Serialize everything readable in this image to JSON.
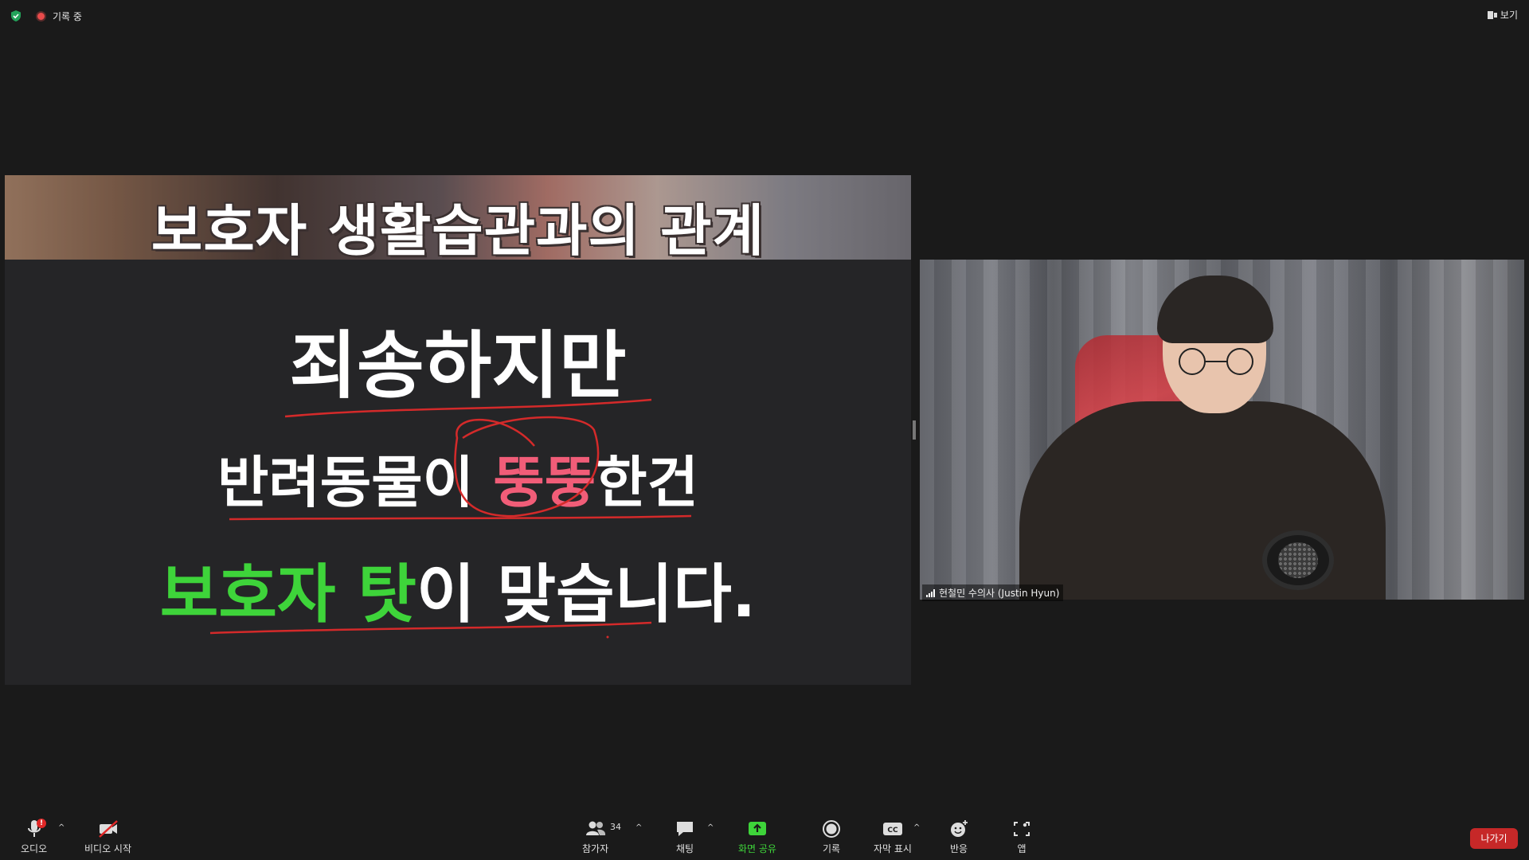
{
  "topbar": {
    "recording_label": "기록 중",
    "view_label": "보기"
  },
  "slide": {
    "title": "보호자 생활습관과의 관계",
    "line1": "죄송하지만",
    "line2_pre": "반려동물이 ",
    "line2_highlight": "뚱뚱",
    "line2_post": "한건",
    "line3_highlight": "보호자 탓",
    "line3_post": "이 맞습니다.",
    "colors": {
      "highlight_pink": "#f15d78",
      "highlight_green": "#3ed43a",
      "annotation_red": "#d42a2a"
    }
  },
  "video": {
    "participant_name": "현철민 수의사 (Justin Hyun)"
  },
  "toolbar": {
    "audio_label": "오디오",
    "audio_badge": "!",
    "video_label": "비디오 시작",
    "participants_label": "참가자",
    "participants_count": "34",
    "chat_label": "채팅",
    "share_label": "화면 공유",
    "record_label": "기록",
    "captions_label": "자막 표시",
    "captions_icon_text": "CC",
    "reactions_label": "반응",
    "apps_label": "앱",
    "leave_label": "나가기",
    "icons": [
      "microphone-icon",
      "video-off-icon",
      "participants-icon",
      "chat-icon",
      "share-screen-icon",
      "record-icon",
      "closed-captions-icon",
      "reactions-icon",
      "apps-icon"
    ]
  }
}
